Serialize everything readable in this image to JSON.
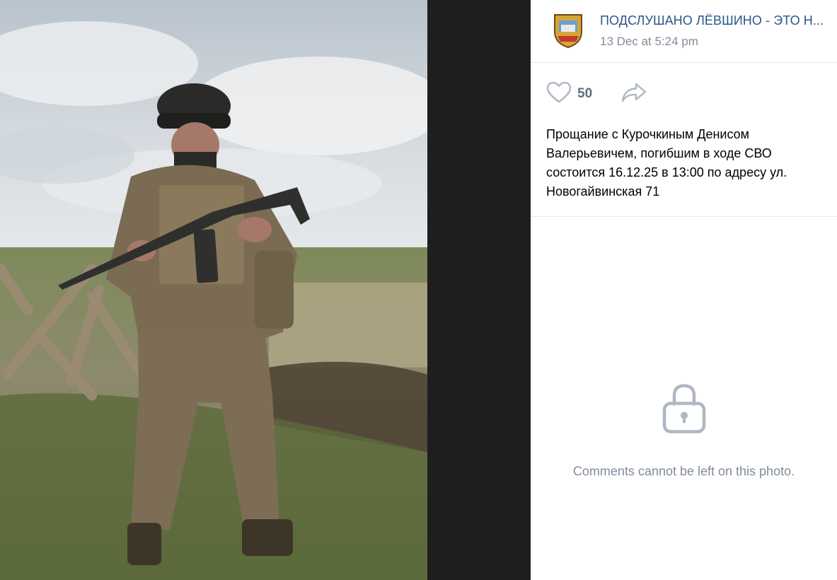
{
  "post": {
    "group_name": "ПОДСЛУШАНО ЛЁВШИНО - ЭТО Н...",
    "date": "13 Dec at 5:24 pm",
    "likes": "50",
    "caption": "Прощание с Курочкиным Денисом Валерьевичем, погибшим в ходе СВО состоится 16.12.25 в 13:00 по адресу ул. Новогайвинская 71"
  },
  "comments": {
    "message": "Comments cannot be left on this photo."
  },
  "icons": {
    "like": "heart-icon",
    "share": "share-arrow-icon",
    "lock": "lock-icon"
  },
  "colors": {
    "link": "#2a5885",
    "secondary": "#818c99",
    "icon": "#aeb7c2"
  }
}
